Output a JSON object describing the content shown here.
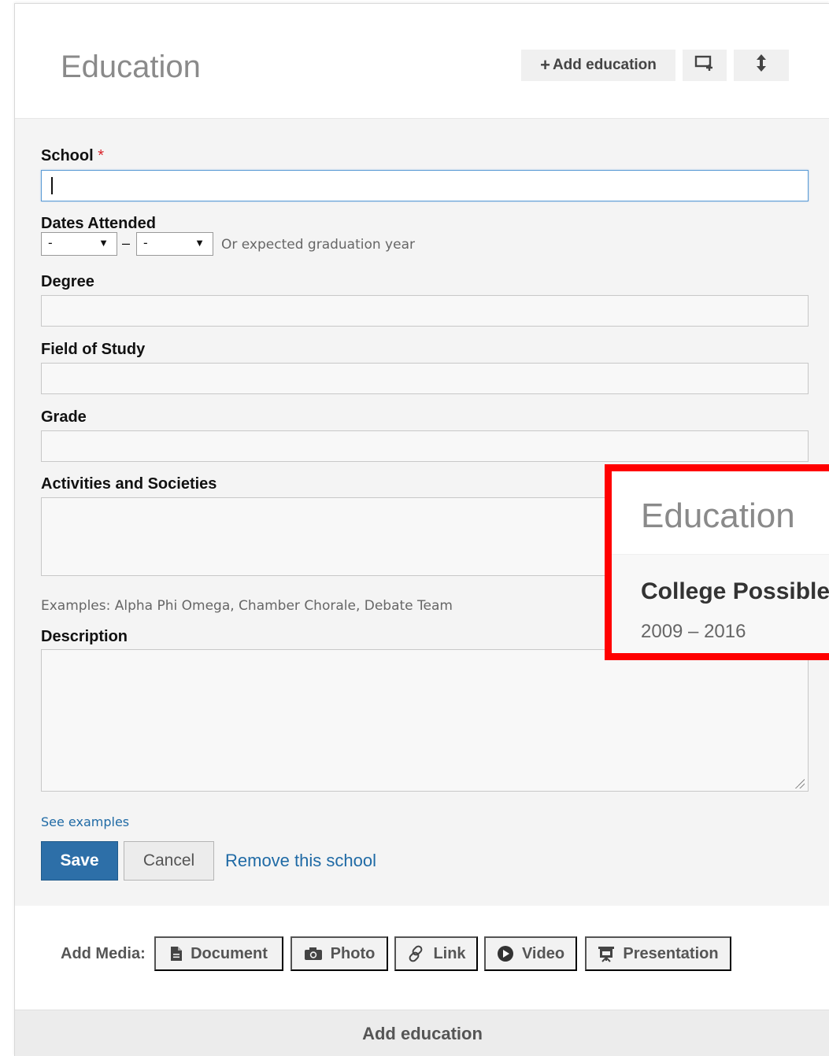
{
  "header": {
    "title": "Education",
    "add_label": "Add education",
    "add_prefix": "+"
  },
  "form": {
    "school_label": "School",
    "required_mark": "*",
    "school_value": "",
    "dates_label": "Dates Attended",
    "date_from": "-",
    "date_to": "-",
    "dates_separator": "–",
    "dates_hint": "Or expected graduation year",
    "degree_label": "Degree",
    "field_label": "Field of Study",
    "grade_label": "Grade",
    "activities_label": "Activities and Societies",
    "activities_hint": "Examples: Alpha Phi Omega, Chamber Chorale, Debate Team",
    "description_label": "Description",
    "see_examples": "See examples",
    "save": "Save",
    "cancel": "Cancel",
    "remove": "Remove this school"
  },
  "media": {
    "label": "Add Media:",
    "buttons": [
      {
        "label": "Document",
        "icon": "document-icon"
      },
      {
        "label": "Photo",
        "icon": "camera-icon"
      },
      {
        "label": "Link",
        "icon": "link-icon"
      },
      {
        "label": "Video",
        "icon": "play-icon"
      },
      {
        "label": "Presentation",
        "icon": "presentation-icon"
      }
    ]
  },
  "footer": {
    "add_label": "Add education"
  },
  "overlay": {
    "title": "Education",
    "school": "College Possible",
    "dates": "2009 – 2016",
    "border_color": "#ff0000"
  },
  "colors": {
    "primary": "#2d6fa8",
    "link": "#1f6aa5",
    "required": "#d8232a"
  }
}
